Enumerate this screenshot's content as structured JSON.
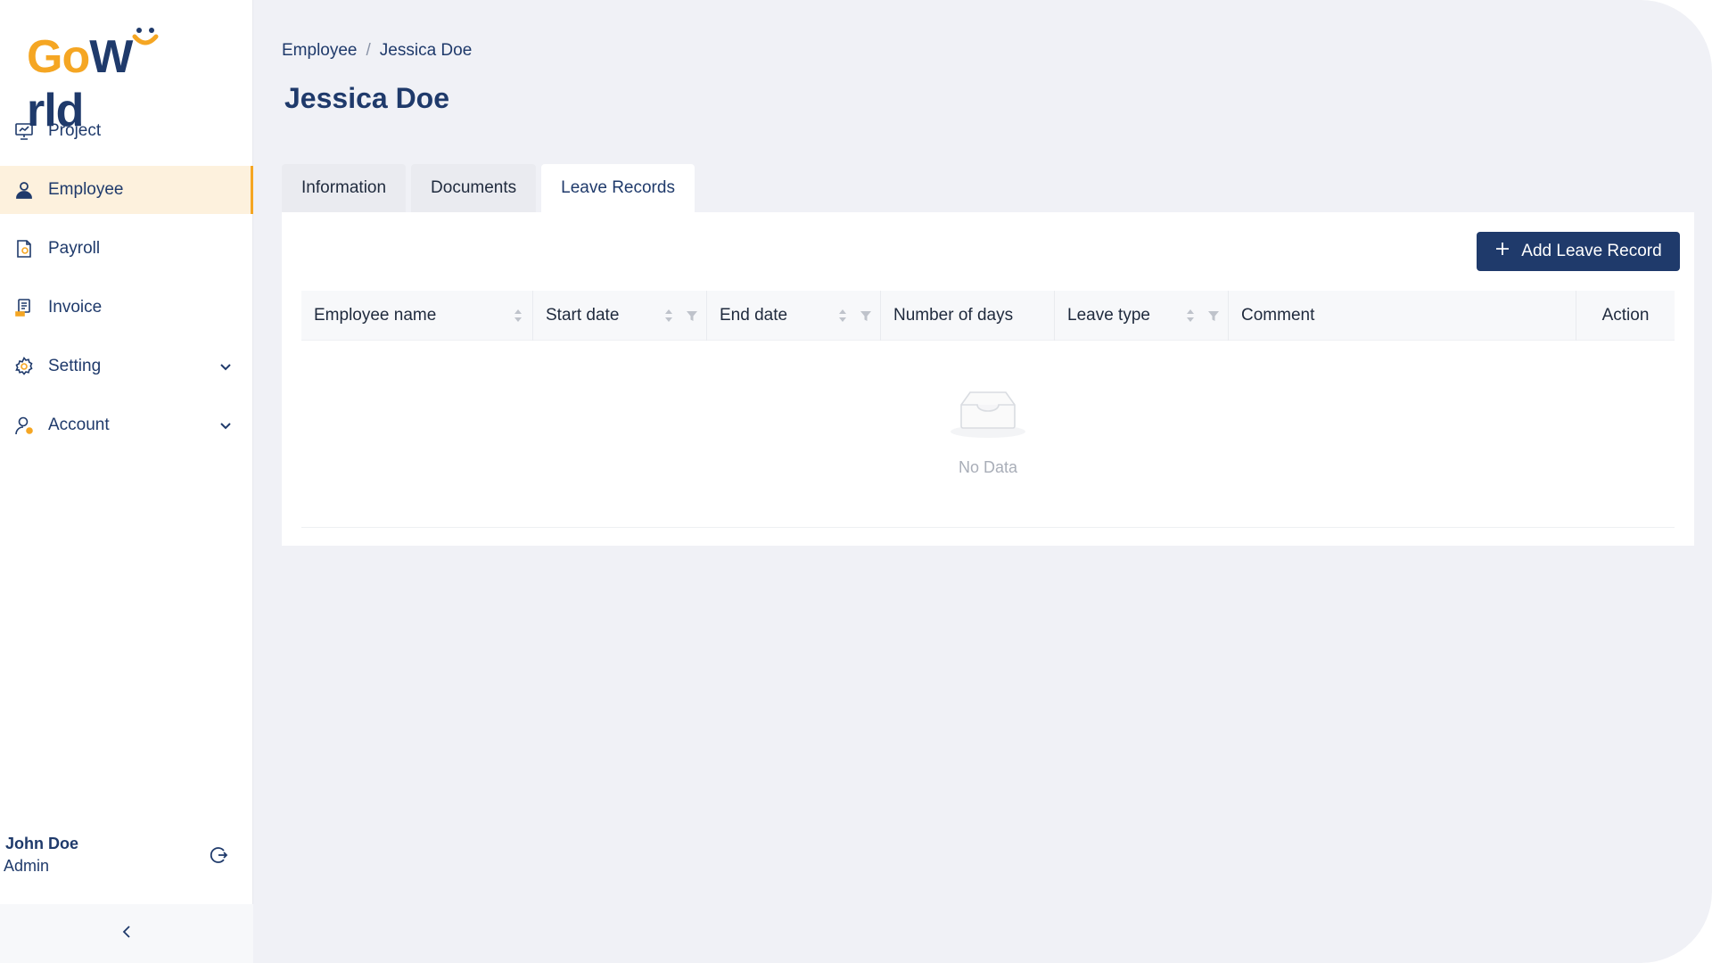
{
  "brand": {
    "logo_go": "Go",
    "logo_w": "W",
    "logo_rld": "rld",
    "accent": "#f5a623",
    "primary": "#1f3a6b"
  },
  "sidebar": {
    "items": [
      {
        "label": "Project",
        "icon": "presentation-icon"
      },
      {
        "label": "Employee",
        "icon": "user-icon",
        "active": true
      },
      {
        "label": "Payroll",
        "icon": "payroll-doc-icon"
      },
      {
        "label": "Invoice",
        "icon": "invoice-icon"
      },
      {
        "label": "Setting",
        "icon": "gear-icon",
        "expandable": true
      },
      {
        "label": "Account",
        "icon": "account-icon",
        "expandable": true
      }
    ],
    "user": {
      "name": "John Doe",
      "role": "Admin"
    }
  },
  "breadcrumb": {
    "parent": "Employee",
    "separator": "/",
    "current": "Jessica Doe"
  },
  "page": {
    "title": "Jessica Doe"
  },
  "tabs": [
    {
      "label": "Information"
    },
    {
      "label": "Documents"
    },
    {
      "label": "Leave Records",
      "active": true
    }
  ],
  "toolbar": {
    "add_label": "Add Leave Record"
  },
  "table": {
    "columns": [
      {
        "label": "Employee name",
        "sortable": true,
        "filterable": false
      },
      {
        "label": "Start date",
        "sortable": true,
        "filterable": true
      },
      {
        "label": "End date",
        "sortable": true,
        "filterable": true
      },
      {
        "label": "Number of days",
        "sortable": false,
        "filterable": false
      },
      {
        "label": "Leave type",
        "sortable": true,
        "filterable": true
      },
      {
        "label": "Comment",
        "sortable": false,
        "filterable": false
      },
      {
        "label": "Action",
        "sortable": false,
        "filterable": false
      }
    ],
    "rows": [],
    "empty_text": "No Data"
  }
}
